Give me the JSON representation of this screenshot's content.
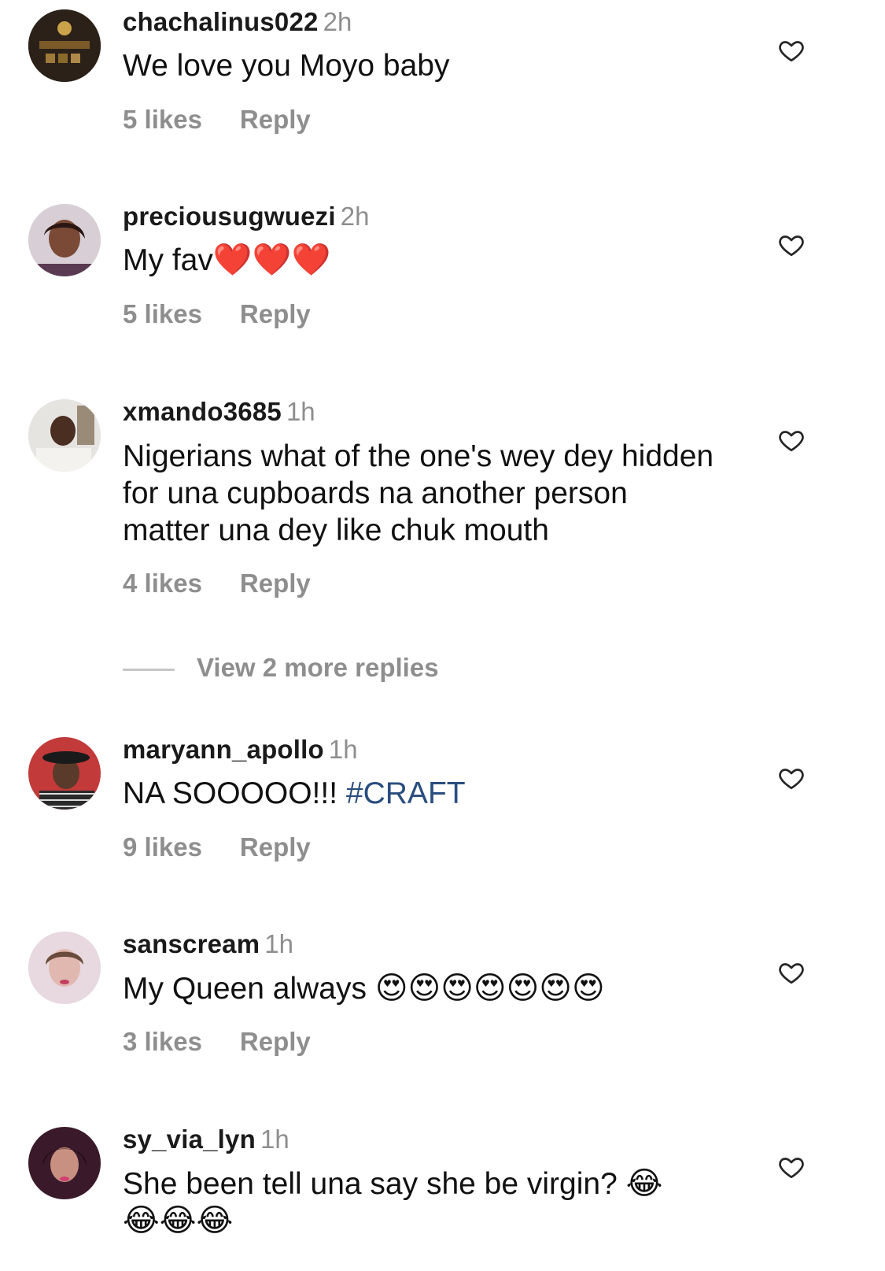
{
  "comments": [
    {
      "username": "chachalinus022",
      "time": "2h",
      "text": "We love you Moyo baby",
      "likes": "5 likes",
      "reply": "Reply"
    },
    {
      "username": "preciousugwuezi",
      "time": "2h",
      "text": "My fav",
      "emoji": "❤️❤️❤️",
      "likes": "5 likes",
      "reply": "Reply"
    },
    {
      "username": "xmando3685",
      "time": "1h",
      "text": "Nigerians what of the one's wey dey hidden for una cupboards na another person matter una dey like chuk mouth",
      "likes": "4 likes",
      "reply": "Reply"
    },
    {
      "username": "maryann_apollo",
      "time": "1h",
      "text": "NA SOOOOO!!!",
      "hashtag": "#CRAFT",
      "likes": "9 likes",
      "reply": "Reply"
    },
    {
      "username": "sanscream",
      "time": "1h",
      "text": "My Queen always",
      "emoji": "😍😍😍😍😍😍😍",
      "likes": "3 likes",
      "reply": "Reply"
    },
    {
      "username": "sy_via_lyn",
      "time": "1h",
      "text": "She been tell una say she be virgin?",
      "emoji": "😂",
      "emoji2": "😂😂😂"
    }
  ],
  "view_more": "View 2 more replies",
  "icons": {
    "like": "heart-outline-icon"
  },
  "colors": {
    "username": "#1a1a1a",
    "muted": "#8e8e8e",
    "hashtag": "#2a4d7f"
  }
}
